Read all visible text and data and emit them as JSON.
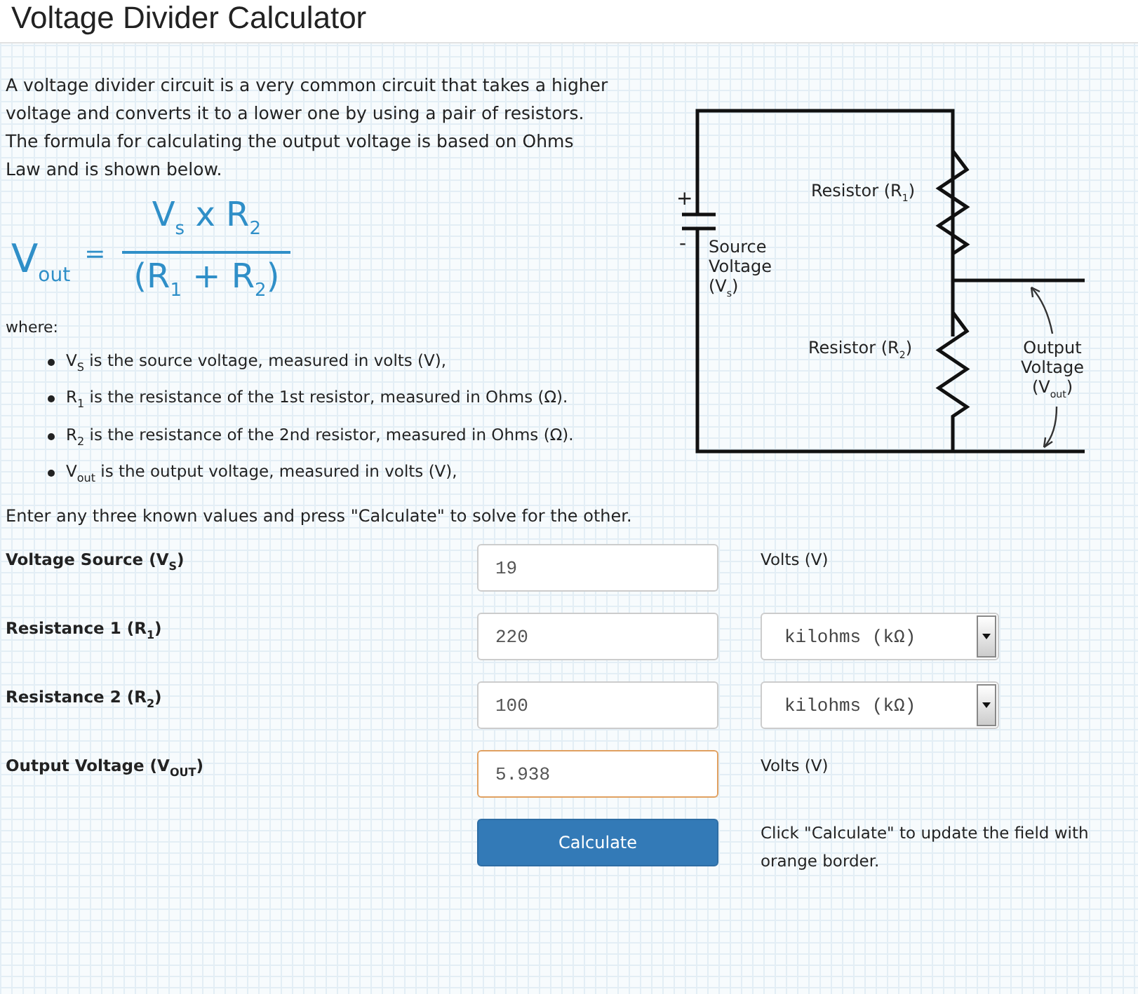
{
  "title": "Voltage Divider Calculator",
  "intro": "A voltage divider circuit is a very common circuit that takes a higher voltage and converts it to a lower one by using a pair of resistors. The formula for calculating the output voltage is based on Ohms Law and is shown below.",
  "formula": {
    "lhs": "V$_{out}$",
    "equals": "=",
    "numerator": "V$_{s}$ x R$_{2}$",
    "denominator": "(R$_{1}$ + R$_{2}$)"
  },
  "where": "where:",
  "definitions": [
    "V$_{S}$ is the source voltage, measured in volts (V),",
    "R$_{1}$ is the resistance of the 1st resistor, measured in Ohms (Ω).",
    "R$_{2}$ is the resistance of the 2nd resistor, measured in Ohms (Ω).",
    "V$_{out}$ is the output voltage, measured in volts (V),"
  ],
  "diagram": {
    "plus": "+",
    "minus": "-",
    "labels": [
      "Source Voltage (V$_{s}$)",
      "Resistor (R$_{1}$)",
      "Resistor (R$_{2}$)",
      "Output Voltage (V$_{out}$)"
    ]
  },
  "instruction": "Enter any three known values and press \"Calculate\" to solve for the other.",
  "fields": [
    {
      "label": "Voltage Source (V$_{S}$)",
      "value": "19",
      "highlighted": false,
      "kind": "text",
      "unit": "Volts (V)"
    },
    {
      "label": "Resistance 1 (R$_{1}$)",
      "value": "220",
      "highlighted": false,
      "kind": "select",
      "unit": "kilohms (kΩ)"
    },
    {
      "label": "Resistance 2 (R$_{2}$)",
      "value": "100",
      "highlighted": false,
      "kind": "select",
      "unit": "kilohms (kΩ)"
    },
    {
      "label": "Output Voltage (V$_{OUT}$)",
      "value": "5.938",
      "highlighted": true,
      "kind": "text",
      "unit": "Volts (V)"
    }
  ],
  "button": "Calculate",
  "note": "Click \"Calculate\" to update the field with orange border."
}
